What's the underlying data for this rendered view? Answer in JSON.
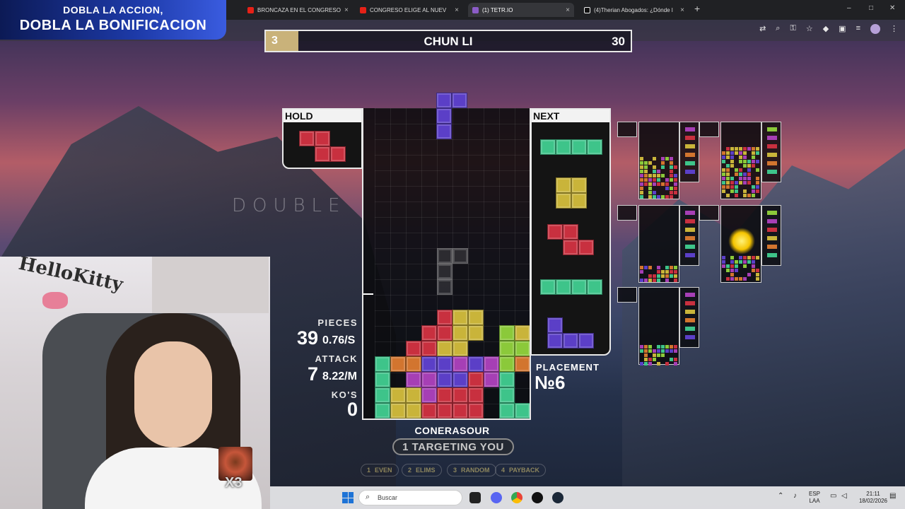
{
  "browser": {
    "tabs": [
      {
        "label": "BRONCAZA EN EL CONGRESO",
        "active": false
      },
      {
        "label": "CONGRESO ELIGE AL NUEV",
        "active": false
      },
      {
        "label": "(1) TETR.IO",
        "active": true
      },
      {
        "label": "(4)Therian Abogados: ¿Dónde l",
        "active": false
      }
    ],
    "new_tab": "+",
    "window_controls": [
      "–",
      "□",
      "✕"
    ]
  },
  "promo": {
    "line1": "DOBLA LA ACCION,",
    "line2": "DOBLA LA BONIFICACION"
  },
  "opponent": {
    "rank": "3",
    "name": "CHUN LI",
    "score": "30"
  },
  "hold": {
    "label": "HOLD",
    "piece": "Z",
    "color": "#c8303f"
  },
  "next": {
    "label": "NEXT",
    "queue": [
      "I",
      "O",
      "Z",
      "I",
      "J"
    ]
  },
  "board": {
    "overlay_text": "DOUBLE"
  },
  "stats": {
    "pieces_label": "PIECES",
    "pieces_value": "39",
    "pieces_rate": "0.76/S",
    "attack_label": "ATTACK",
    "attack_value": "7",
    "attack_rate": "8.22/M",
    "kos_label": "KO'S",
    "kos_value": "0"
  },
  "placement": {
    "label": "PLACEMENT",
    "value": "№6"
  },
  "player": {
    "name": "CONERASOUR",
    "targeting": "1 TARGETING YOU"
  },
  "strategies": [
    {
      "num": "1",
      "label": "EVEN"
    },
    {
      "num": "2",
      "label": "ELIMS"
    },
    {
      "num": "3",
      "label": "RANDOM"
    },
    {
      "num": "4",
      "label": "PAYBACK"
    }
  ],
  "webcam": {
    "decor_text": "HelloKitty",
    "emote_count": "X3"
  },
  "taskbar": {
    "search_placeholder": "Buscar",
    "lang_line1": "ESP",
    "lang_line2": "LAA",
    "time": "21:11",
    "date": "18/02/2026"
  },
  "colors": {
    "Z": "#c8303f",
    "S": "#8bc93a",
    "I": "#3ec48a",
    "O": "#c9b43a",
    "T": "#a63fb5",
    "J": "#5b3fc7",
    "L": "#d2752f",
    "garbage": "#5a5a5a"
  }
}
